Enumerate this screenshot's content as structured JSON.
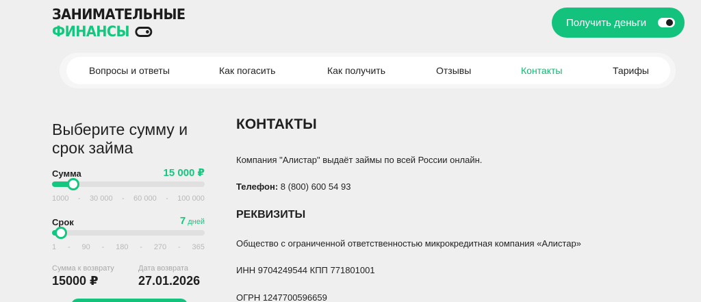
{
  "logo": {
    "line1": "ЗАНИМАТЕЛЬНЫЕ",
    "line2": "ФИНАНСЫ"
  },
  "header": {
    "cta_label": "Получить деньги"
  },
  "nav": {
    "items": [
      {
        "label": "Вопросы и ответы"
      },
      {
        "label": "Как погасить"
      },
      {
        "label": "Как получить"
      },
      {
        "label": "Отзывы"
      },
      {
        "label": "Контакты"
      },
      {
        "label": "Тарифы"
      }
    ],
    "active": "Контакты"
  },
  "calculator": {
    "title_line1": "Выберите сумму и",
    "title_line2": "срок займа",
    "amount": {
      "label": "Сумма",
      "value": "15 000 ₽",
      "fraction": 0.14,
      "ticks": [
        "1000",
        "-",
        "30 000",
        "-",
        "60 000",
        "-",
        "100 000"
      ]
    },
    "term": {
      "label": "Срок",
      "value": "7",
      "unit": "дней",
      "fraction": 0.06,
      "ticks": [
        "1",
        "-",
        "90",
        "-",
        "180",
        "-",
        "270",
        "-",
        "365"
      ]
    },
    "return_sum_label": "Сумма к возврату",
    "return_sum_value": "15000 ₽",
    "return_date_label": "Дата возврата",
    "return_date_value": "27.01.2026"
  },
  "content": {
    "title": "КОНТАКТЫ",
    "intro": "Компания \"Алистар\" выдаёт займы по всей России онлайн.",
    "phone_label": "Телефон:",
    "phone_value": " 8 (800) 600 54 93",
    "requisites_title": "РЕКВИЗИТЫ",
    "company_name": "Общество с ограниченной ответственностью микрокредитная компания «Алистар»",
    "inn_kpp": "ИНН 9704249544 КПП 771801001",
    "ogrn": "ОГРН 1247700596659"
  },
  "colors": {
    "accent": "#13c27c",
    "background": "#efefef",
    "text": "#1f1f1f"
  }
}
